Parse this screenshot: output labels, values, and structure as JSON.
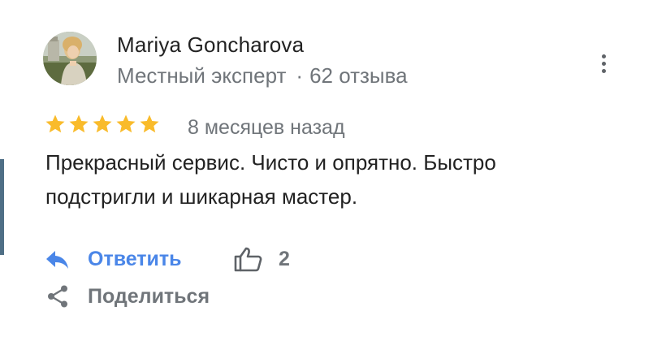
{
  "review": {
    "author": {
      "name": "Mariya Goncharova",
      "badge": "Местный эксперт",
      "separator": "·",
      "reviews_count": "62 отзыва",
      "avatar_icon": "user-avatar-photo"
    },
    "rating": 5,
    "rating_max": 5,
    "date": "8 месяцев назад",
    "text": "Прекрасный сервис. Чисто и опрятно. Быстро подстригли и шикарная мастер.",
    "actions": {
      "reply_label": "Ответить",
      "like_count": "2",
      "share_label": "Поделиться"
    },
    "icons": {
      "more": "more-vert-icon",
      "star": "star-icon",
      "reply": "reply-arrow-icon",
      "like": "thumb-up-icon",
      "share": "share-icon"
    },
    "colors": {
      "star": "#f9bb2b",
      "link": "#4a86e8",
      "secondary_text": "#70757a",
      "primary_text": "#222222"
    }
  }
}
